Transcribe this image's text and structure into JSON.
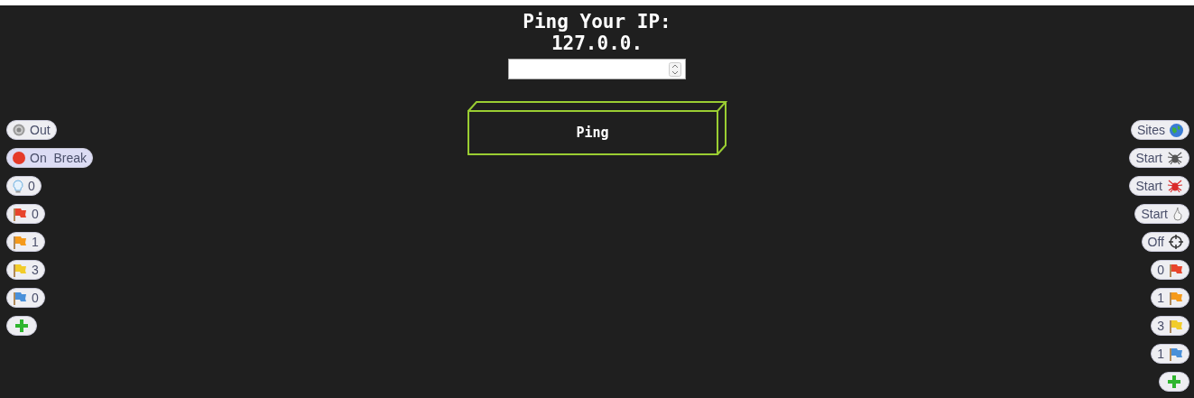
{
  "header": {
    "title": "Ping Your IP:",
    "ip": "127.0.0."
  },
  "ping_button": {
    "label": "Ping"
  },
  "left_pills": [
    {
      "kind": "target",
      "label": "Out",
      "selected": false
    },
    {
      "kind": "dot",
      "label": "On  Break",
      "selected": true
    },
    {
      "kind": "bulb",
      "label": "0",
      "selected": false
    },
    {
      "kind": "flag",
      "label": "0",
      "color": "#e8452c",
      "selected": false
    },
    {
      "kind": "flag",
      "label": "1",
      "color": "#f59a1b",
      "selected": false
    },
    {
      "kind": "flag",
      "label": "3",
      "color": "#f2cc2a",
      "selected": false
    },
    {
      "kind": "flag",
      "label": "0",
      "color": "#4a90d9",
      "selected": false
    },
    {
      "kind": "plus",
      "selected": false
    }
  ],
  "right_pills": [
    {
      "kind": "globe",
      "label": "Sites"
    },
    {
      "kind": "spider",
      "label": "Start",
      "color": "#555555"
    },
    {
      "kind": "spider",
      "label": "Start",
      "color": "#d92a2a"
    },
    {
      "kind": "flame",
      "label": "Start"
    },
    {
      "kind": "crosshair",
      "label": "Off"
    },
    {
      "kind": "flag",
      "label": "0",
      "color": "#e8452c"
    },
    {
      "kind": "flag",
      "label": "1",
      "color": "#f59a1b"
    },
    {
      "kind": "flag",
      "label": "3",
      "color": "#f2cc2a"
    },
    {
      "kind": "flag",
      "label": "1",
      "color": "#4a90d9"
    },
    {
      "kind": "plus"
    }
  ]
}
